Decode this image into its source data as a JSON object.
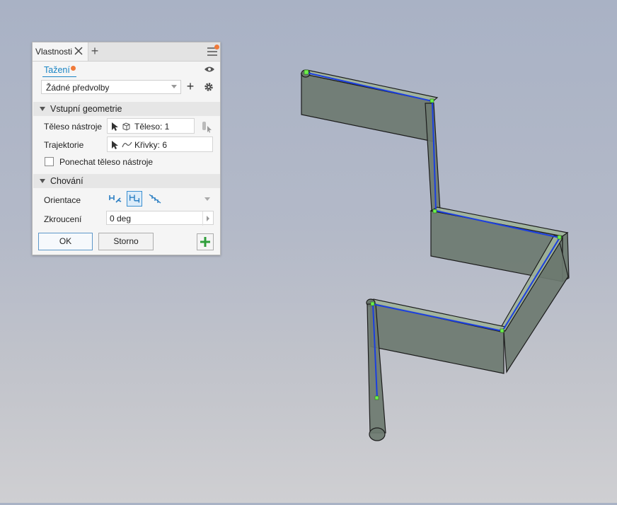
{
  "panel": {
    "tab_label": "Vlastnosti",
    "command_title": "Tažení",
    "preset_value": "Žádné předvolby",
    "section_input": "Vstupní geometrie",
    "profile_label": "Těleso nástroje",
    "profile_value": "Těleso: 1",
    "path_label": "Trajektorie",
    "path_value": "Křivky: 6",
    "keep_tool_label": "Ponechat těleso nástroje",
    "section_behavior": "Chování",
    "orientation_label": "Orientace",
    "twist_label": "Zkroucení",
    "twist_value": "0 deg",
    "ok_label": "OK",
    "cancel_label": "Storno"
  },
  "colors": {
    "accent": "#1a85c4",
    "notification": "#f07a3a",
    "add_green": "#2f9e3a",
    "path_blue": "#1b3fe0",
    "solid_fill": "#6d7a70",
    "endpoint_green": "#6cf04a"
  },
  "icons": [
    "close-icon",
    "add-tab-icon",
    "menu-icon",
    "eye-icon",
    "add-icon",
    "gear-icon",
    "cursor-icon",
    "solid-body-icon",
    "curve-icon",
    "orientation-path-icon",
    "orientation-fixed-icon",
    "orientation-guide-icon",
    "add-green-icon"
  ]
}
